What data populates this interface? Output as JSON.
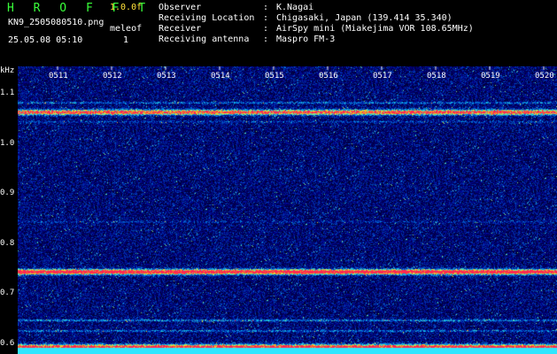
{
  "header": {
    "title": "H R O F F T",
    "version": "1.0.0f",
    "filename": "KN9_2505080510.png",
    "meleo_label": "meleof",
    "timestamp": "25.05.08 05:10",
    "meleo_value": "1",
    "info": [
      {
        "label": "Observer",
        "sep": ":",
        "value": "K.Nagai"
      },
      {
        "label": "Receiving Location",
        "sep": ":",
        "value": "Chigasaki, Japan (139.414 35.340)"
      },
      {
        "label": "Receiver",
        "sep": ":",
        "value": "AirSpy mini (Miakejima VOR 108.65MHz)"
      },
      {
        "label": "Receiving antenna",
        "sep": ":",
        "value": "Maspro FM-3"
      }
    ]
  },
  "chart_data": {
    "type": "heatmap",
    "y_unit": "kHz",
    "y_ticks": [
      "1.1",
      "1.0",
      "0.9",
      "0.8",
      "0.7",
      "0.6"
    ],
    "ylim": [
      0.58,
      1.155
    ],
    "x_ticks": [
      "0511",
      "0512",
      "0513",
      "0514",
      "0515",
      "0516",
      "0517",
      "0518",
      "0519",
      "0520"
    ],
    "bands": [
      {
        "freq_khz": 1.083,
        "intensity": 0.25
      },
      {
        "freq_khz": 1.064,
        "intensity": 0.85
      },
      {
        "freq_khz": 1.045,
        "intensity": 0.15
      },
      {
        "freq_khz": 0.845,
        "intensity": 0.12
      },
      {
        "freq_khz": 0.745,
        "intensity": 1.0
      },
      {
        "freq_khz": 0.648,
        "intensity": 0.3
      },
      {
        "freq_khz": 0.627,
        "intensity": 0.25
      },
      {
        "freq_khz": 0.595,
        "intensity": 0.9
      }
    ]
  }
}
